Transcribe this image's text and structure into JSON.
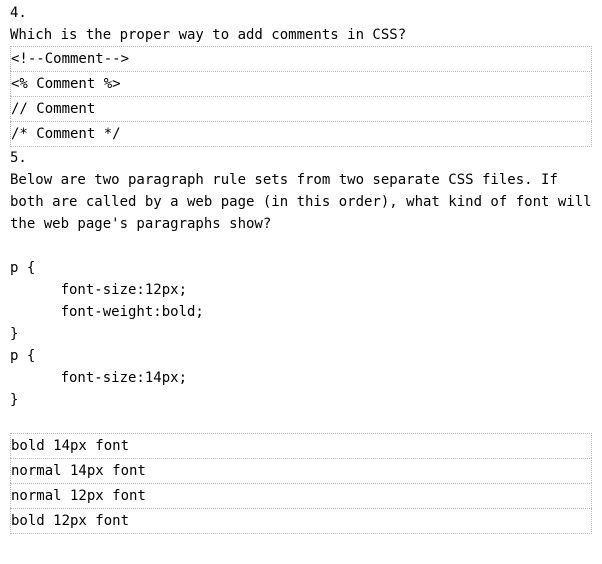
{
  "q4": {
    "number": "4.",
    "prompt": "Which is the proper way to add comments in CSS?",
    "answers": [
      "<!--Comment-->",
      "<% Comment %>",
      "// Comment",
      "/* Comment */"
    ]
  },
  "q5": {
    "number": "5.",
    "prompt": "Below are two paragraph rule sets from two separate CSS files. If both are called by a web page (in this order), what kind of font will the web page's paragraphs show?",
    "code": "p {\n      font-size:12px;\n      font-weight:bold;\n}\np {\n      font-size:14px;\n}",
    "answers": [
      "bold 14px font",
      "normal 14px font",
      "normal 12px font",
      "bold 12px font"
    ]
  }
}
